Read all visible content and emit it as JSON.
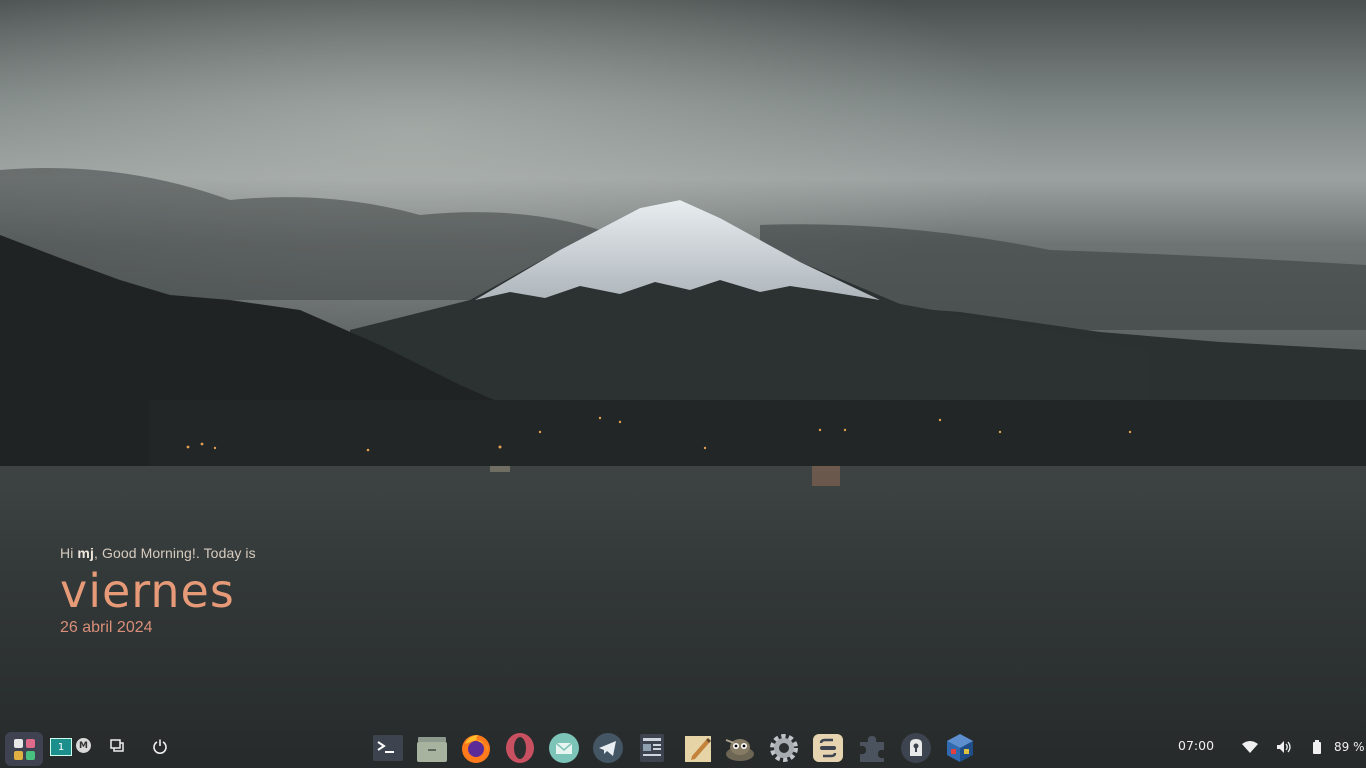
{
  "desktop": {
    "wallpaper": "Mount Fuji at dusk over a lake",
    "greeting": {
      "prefix": "Hi ",
      "user": "mj",
      "suffix": ", Good Morning!. Today is",
      "day": "viernes",
      "date": "26 abril 2024"
    }
  },
  "taskbar": {
    "workspace_number": "1",
    "badge_letter": "M",
    "dock": [
      {
        "name": "terminal-icon"
      },
      {
        "name": "file-manager-icon"
      },
      {
        "name": "firefox-icon"
      },
      {
        "name": "opera-icon"
      },
      {
        "name": "mail-icon"
      },
      {
        "name": "telegram-icon"
      },
      {
        "name": "news-reader-icon"
      },
      {
        "name": "text-editor-icon"
      },
      {
        "name": "gimp-icon"
      },
      {
        "name": "settings-icon"
      },
      {
        "name": "switch-icon"
      },
      {
        "name": "extensions-icon"
      },
      {
        "name": "password-manager-icon"
      },
      {
        "name": "virtualbox-icon"
      }
    ],
    "clock": "07:00",
    "battery": "89 %"
  },
  "colors": {
    "greeting_day": "#e69a78",
    "greeting_date": "#d98f7a",
    "workspace": "#1c8f8d",
    "menu_button": "#3f4250"
  }
}
